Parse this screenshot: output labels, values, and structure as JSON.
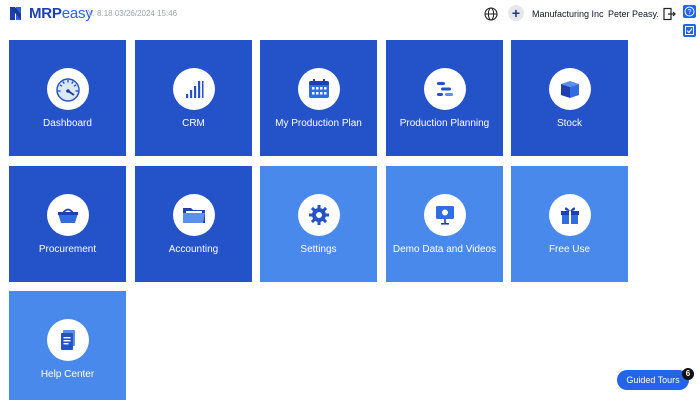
{
  "header": {
    "logo_bold": "MRP",
    "logo_light": "easy",
    "version": "V. 8.18  03/26/2024 15:46",
    "plus_label": "+",
    "company": "Manufacturing Inc",
    "user": "Peter Peasy."
  },
  "tiles": [
    {
      "label": "Dashboard",
      "icon": "dashboard-icon"
    },
    {
      "label": "CRM",
      "icon": "crm-icon"
    },
    {
      "label": "My Production Plan",
      "icon": "calendar-icon"
    },
    {
      "label": "Production Planning",
      "icon": "gantt-icon"
    },
    {
      "label": "Stock",
      "icon": "box-icon"
    },
    {
      "label": "Procurement",
      "icon": "basket-icon"
    },
    {
      "label": "Accounting",
      "icon": "folder-icon"
    },
    {
      "label": "Settings",
      "icon": "gear-icon"
    },
    {
      "label": "Demo Data and Videos",
      "icon": "presentation-icon"
    },
    {
      "label": "Free Use",
      "icon": "gift-icon"
    },
    {
      "label": "Help Center",
      "icon": "document-icon"
    }
  ],
  "guided_tours": {
    "label": "Guided Tours",
    "count": "6"
  },
  "colors": {
    "tile_dark": "#2452c9",
    "tile_light": "#4a89ec",
    "accent": "#2563eb"
  }
}
